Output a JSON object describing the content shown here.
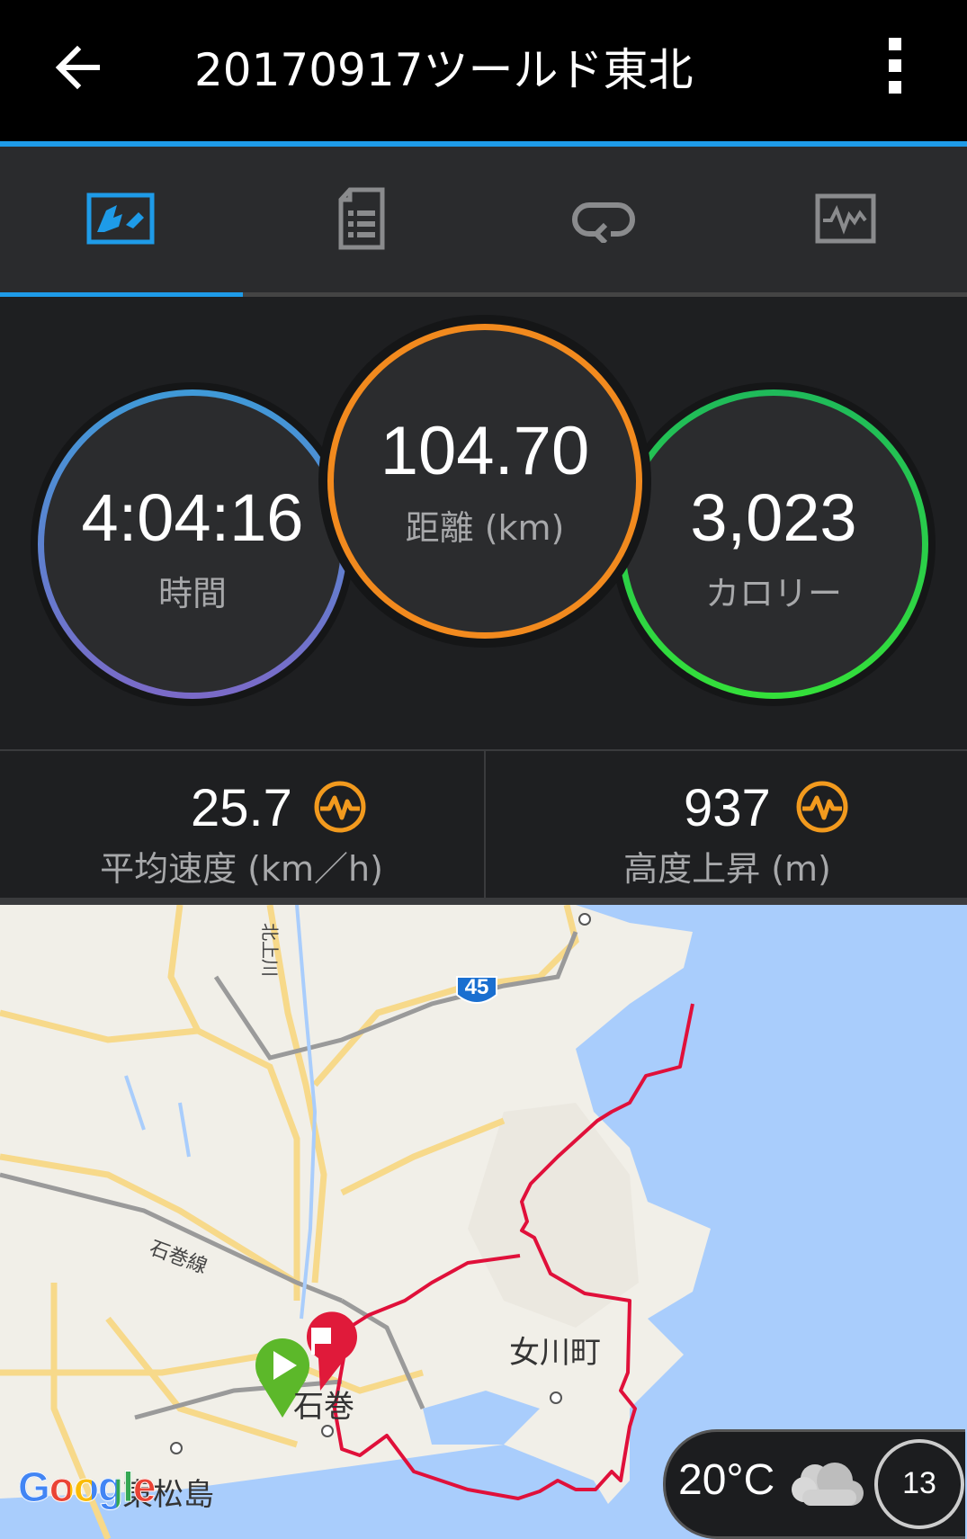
{
  "appbar": {
    "title": "20170917ツールド東北",
    "back_icon": "arrow-left-icon",
    "more_icon": "more-vert-icon"
  },
  "tabs": [
    {
      "name": "map-tab",
      "icon": "map-icon",
      "active": true
    },
    {
      "name": "details-tab",
      "icon": "document-list-icon",
      "active": false
    },
    {
      "name": "laps-tab",
      "icon": "loop-icon",
      "active": false
    },
    {
      "name": "charts-tab",
      "icon": "chart-icon",
      "active": false
    }
  ],
  "summary": {
    "time": {
      "value": "4:04:16",
      "label": "時間"
    },
    "distance": {
      "value": "104.70",
      "label": "距離 (km)"
    },
    "calories": {
      "value": "3,023",
      "label": "カロリー"
    }
  },
  "stats": {
    "avg_speed": {
      "value": "25.7",
      "label": "平均速度 (km／h)",
      "icon": "pulse-icon"
    },
    "elevation_gain": {
      "value": "937",
      "label": "高度上昇 (m)",
      "icon": "pulse-icon"
    }
  },
  "map": {
    "places": {
      "ishinomaki": "石巻",
      "onagawa": "女川町",
      "higashimatsushima": "東松島",
      "railway": "石巻線",
      "river": "北上川",
      "route_number": "45"
    },
    "logo": "Google",
    "weather": {
      "temperature": "20°C",
      "icon": "cloud-icon",
      "wind": "13"
    }
  },
  "colors": {
    "accent": "#1e9be8",
    "time_ring": "#4a90d9",
    "distance_ring": "#f28a1e",
    "calories_ring": "#2ed14a",
    "route": "#e0103a",
    "start_marker": "#5cb82a",
    "finish_marker": "#e01a3a"
  }
}
